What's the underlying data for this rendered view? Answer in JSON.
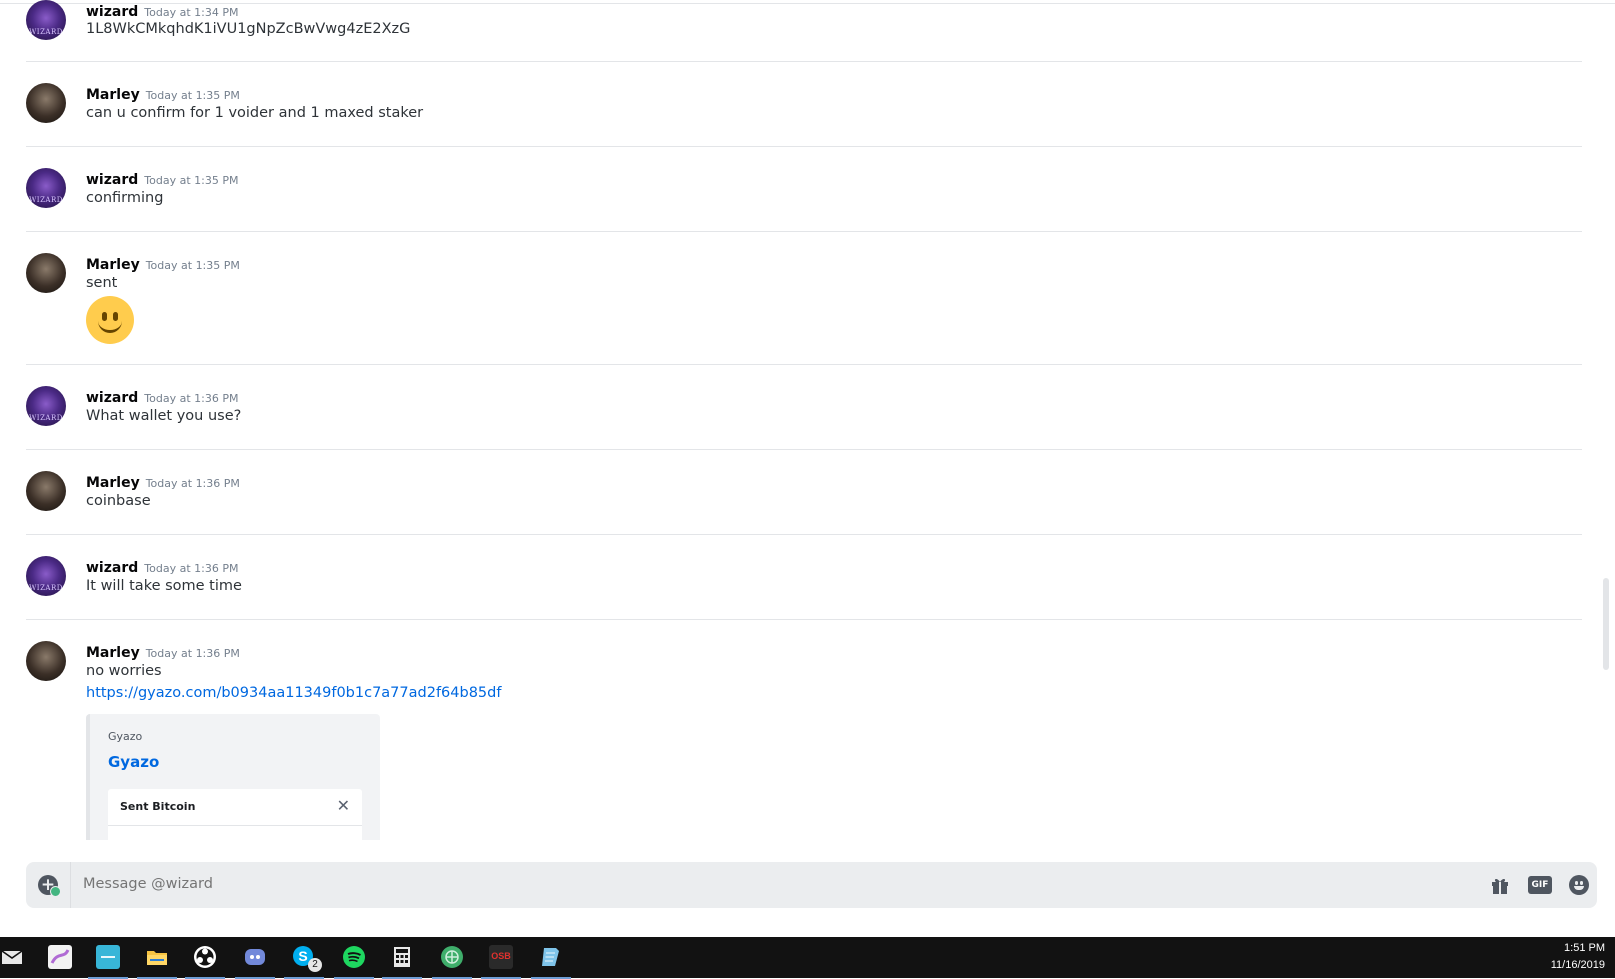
{
  "messages": [
    {
      "author": "wizard",
      "time": "Today at 1:34 PM",
      "text": "1L8WkCMkqhdK1iVU1gNpZcBwVwg4zE2XzG"
    },
    {
      "author": "Marley",
      "time": "Today at 1:35 PM",
      "text": "can u confirm for 1 voider and 1 maxed staker"
    },
    {
      "author": "wizard",
      "time": "Today at 1:35 PM",
      "text": "confirming"
    },
    {
      "author": "Marley",
      "time": "Today at 1:35 PM",
      "text": "sent",
      "emoji": "slightly-smiling-face"
    },
    {
      "author": "wizard",
      "time": "Today at 1:36 PM",
      "text": "What wallet you use?"
    },
    {
      "author": "Marley",
      "time": "Today at 1:36 PM",
      "text": "coinbase"
    },
    {
      "author": "wizard",
      "time": "Today at 1:36 PM",
      "text": "It will take some time"
    },
    {
      "author": "Marley",
      "time": "Today at 1:36 PM",
      "text": "no worries",
      "link": "https://gyazo.com/b0934aa11349f0b1c7a77ad2f64b85df",
      "embed": {
        "provider": "Gyazo",
        "title": "Gyazo",
        "card_title": "Sent Bitcoin",
        "card_close": "✕"
      }
    }
  ],
  "avatar_glyph": "WIZARD",
  "composer": {
    "placeholder": "Message @wizard",
    "gif_label": "GIF"
  },
  "taskbar": {
    "icons": [
      "mail-icon",
      "paint-icon",
      "teal-app-icon",
      "file-explorer-icon",
      "obs-icon",
      "discord-icon",
      "skype-icon",
      "spotify-icon",
      "calculator-icon",
      "globe-app-icon",
      "osb-icon",
      "notepad-icon"
    ],
    "skype_badge": "2",
    "osb_label": "OSB",
    "time": "1:51 PM",
    "date": "11/16/2019"
  },
  "colors": {
    "link": "#0068e0",
    "accent": "#43b581"
  }
}
